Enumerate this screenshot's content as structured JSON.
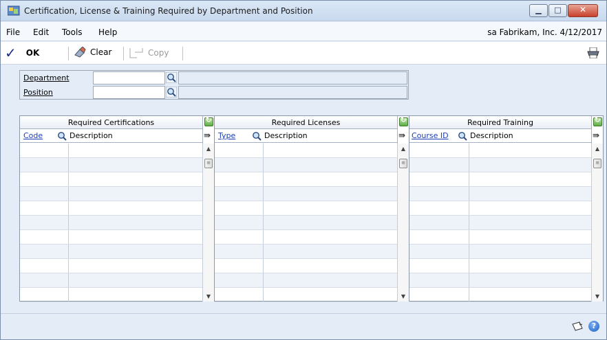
{
  "window": {
    "title": "Certification, License & Training Required by Department and Position"
  },
  "menubar": {
    "items": [
      "File",
      "Edit",
      "Tools",
      "Help"
    ],
    "user_info": "sa  Fabrikam, Inc.  4/12/2017"
  },
  "toolbar": {
    "ok_label": "OK",
    "clear_label": "Clear",
    "copy_label": "Copy"
  },
  "header": {
    "department_label": "Department",
    "position_label": "Position",
    "department_value": "",
    "position_value": ""
  },
  "grids": {
    "certifications": {
      "title": "Required Certifications",
      "col1": "Code",
      "col2": "Description"
    },
    "licenses": {
      "title": "Required Licenses",
      "col1": "Type",
      "col2": "Description"
    },
    "training": {
      "title": "Required Training",
      "col1": "Course ID",
      "col2": "Description"
    }
  },
  "icons": {
    "lookup": "magnifier-icon",
    "refresh": "refresh-icon",
    "expand": "expand-icon",
    "print": "printer-icon",
    "note": "note-icon",
    "help": "help-icon"
  }
}
